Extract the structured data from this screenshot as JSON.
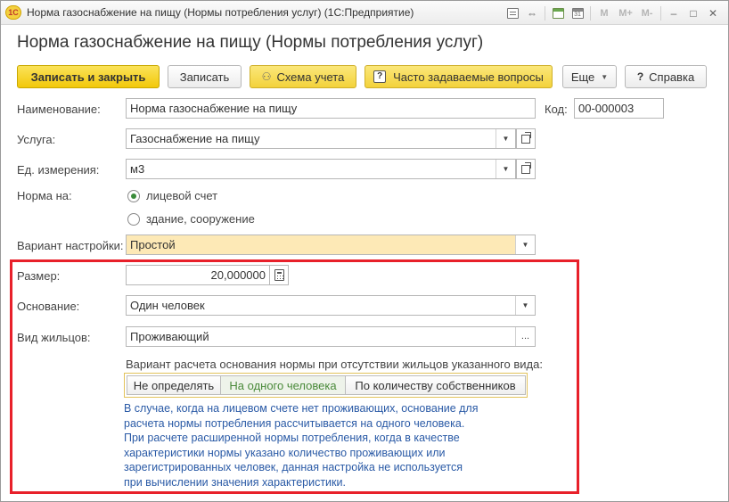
{
  "window": {
    "logo_text": "1С",
    "title": "Норма газоснабжение на пищу (Нормы потребления услуг)  (1С:Предприятие)",
    "m_buttons": [
      "M",
      "M+",
      "M-"
    ],
    "minimize_label": "–",
    "maximize_label": "□",
    "close_label": "✕"
  },
  "header": {
    "title": "Норма газоснабжение на пищу (Нормы потребления услуг)"
  },
  "toolbar": {
    "save_close_label": "Записать и закрыть",
    "save_label": "Записать",
    "scheme_label": "Схема учета",
    "faq_label": "Часто задаваемые вопросы",
    "more_label": "Еще",
    "help_label": "Справка"
  },
  "form": {
    "name_label": "Наименование:",
    "name_value": "Норма газоснабжение на пищу",
    "code_label": "Код:",
    "code_value": "00-000003",
    "service_label": "Услуга:",
    "service_value": "Газоснабжение на пищу",
    "unit_label": "Ед. измерения:",
    "unit_value": "м3",
    "norm_for_label": "Норма на:",
    "norm_options": [
      "лицевой счет",
      "здание, сооружение"
    ],
    "norm_selected": "лицевой счет",
    "variant_label": "Вариант настройки:",
    "variant_value": "Простой",
    "size_label": "Размер:",
    "size_value": "20,000000",
    "basis_label": "Основание:",
    "basis_value": "Один человек",
    "residents_label": "Вид жильцов:",
    "residents_value": "Проживающий",
    "calc_caption": "Вариант расчета основания нормы при отсутствии жильцов указанного вида:",
    "calc_options": [
      "Не определять",
      "На одного человека",
      "По количеству собственников"
    ],
    "calc_selected": "На одного человека",
    "note_lines": [
      "В случае, когда на лицевом счете нет проживающих, основание для",
      "расчета нормы потребления рассчитывается на одного человека.",
      "При расчете расширенной нормы потребления, когда в качестве",
      "характеристики нормы указано количество проживающих или",
      "зарегистрированных человек, данная настройка не используется",
      "при вычислении значения характеристики."
    ]
  },
  "colors": {
    "primary_button": "#f2c80a",
    "highlight_frame": "#e8202a",
    "note_text": "#2a5aa6",
    "active_option": "#4a8a3a"
  }
}
